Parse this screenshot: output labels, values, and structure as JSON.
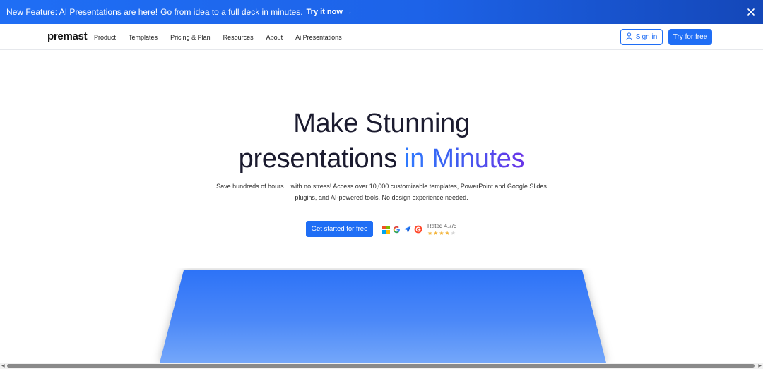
{
  "announcement": {
    "feature": "New Feature: AI Presentations are here!",
    "sub": "Go from idea to a full deck in minutes.",
    "cta": "Try it now →"
  },
  "nav": {
    "logo": "premast",
    "items": [
      "Product",
      "Templates",
      "Pricing & Plan",
      "Resources",
      "About",
      "Ai Presentations"
    ],
    "signin": "Sign in",
    "try_free": "Try for free"
  },
  "hero": {
    "title_line1": "Make Stunning",
    "title_line2_plain": "presentations",
    "title_line2_highlight": "in Minutes",
    "subtitle": "Save hundreds of hours ...with no stress! Access over 10,000 customizable templates, PowerPoint and Google Slides plugins, and AI-powered tools. No design experience needed.",
    "cta": "Get started for free",
    "rating_label": "Rated 4.7/5",
    "rating_value": 4.7,
    "rating_max": 5,
    "platform_icons": [
      "microsoft-icon",
      "google-icon",
      "send-icon",
      "g2-icon"
    ]
  },
  "colors": {
    "brand_blue": "#1f6ef5",
    "headline_dark": "#1b1b2f",
    "highlight_gradient_start": "#2f7bff",
    "highlight_gradient_end": "#6a35e8"
  }
}
